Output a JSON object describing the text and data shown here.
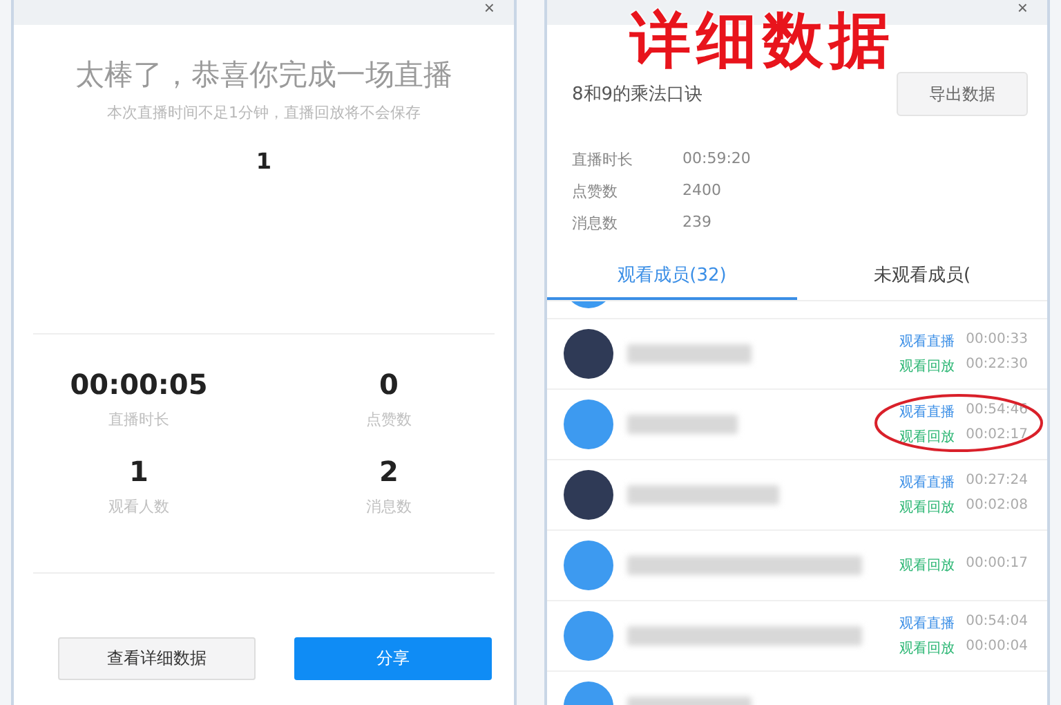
{
  "left_window": {
    "close": "×",
    "title": "太棒了，恭喜你完成一场直播",
    "subtitle": "本次直播时间不足1分钟，直播回放将不会保存",
    "top_count": "1",
    "stats": [
      {
        "value": "00:00:05",
        "label": "直播时长"
      },
      {
        "value": "0",
        "label": "点赞数"
      },
      {
        "value": "1",
        "label": "观看人数"
      },
      {
        "value": "2",
        "label": "消息数"
      }
    ],
    "buttons": [
      {
        "label": "查看详细数据",
        "kind": "secondary"
      },
      {
        "label": "分享",
        "kind": "primary"
      }
    ]
  },
  "right_window": {
    "close": "×",
    "annotation": "详细数据",
    "course_title": "8和9的乘法口诀",
    "export_button": "导出数据",
    "info": [
      {
        "label": "直播时长",
        "value": "00:59:20"
      },
      {
        "label": "点赞数",
        "value": "2400"
      },
      {
        "label": "消息数",
        "value": "239"
      }
    ],
    "tabs": [
      {
        "label": "观看成员(32)",
        "selected": true
      },
      {
        "label": "未观看成员(",
        "selected": false
      }
    ],
    "members": [
      {
        "kind": "default",
        "circled": false
      },
      {
        "kind": "photo",
        "circled": false,
        "entries": [
          {
            "kind": "live",
            "label": "观看直播",
            "time": "00:00:33"
          },
          {
            "kind": "replay",
            "label": "观看回放",
            "time": "00:22:30"
          }
        ]
      },
      {
        "kind": "default",
        "circled": true,
        "entries": [
          {
            "kind": "live",
            "label": "观看直播",
            "time": "00:54:46"
          },
          {
            "kind": "replay",
            "label": "观看回放",
            "time": "00:02:17"
          }
        ]
      },
      {
        "kind": "photo",
        "circled": false,
        "entries": [
          {
            "kind": "live",
            "label": "观看直播",
            "time": "00:27:24"
          },
          {
            "kind": "replay",
            "label": "观看回放",
            "time": "00:02:08"
          }
        ]
      },
      {
        "kind": "default",
        "circled": false,
        "entries": [
          {
            "kind": "replay",
            "label": "观看回放",
            "time": "00:00:17"
          }
        ]
      },
      {
        "kind": "default",
        "circled": false,
        "entries": [
          {
            "kind": "live",
            "label": "观看直播",
            "time": "00:54:04"
          },
          {
            "kind": "replay",
            "label": "观看回放",
            "time": "00:00:04"
          }
        ]
      },
      {
        "kind": "default",
        "circled": false
      }
    ]
  }
}
